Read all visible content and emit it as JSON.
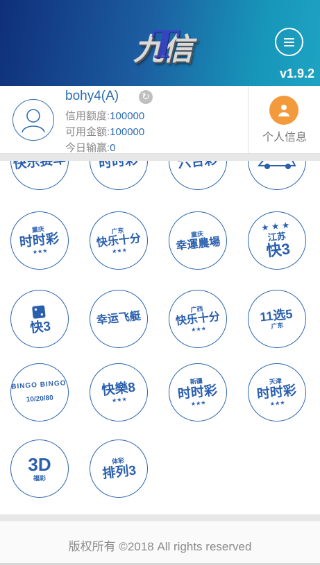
{
  "header": {
    "logo_text": "九信",
    "logo_t": "T",
    "version": "v1.9.2",
    "gradient_colors": [
      "#0f2f7a",
      "#1c5da0",
      "#1ea3c3"
    ]
  },
  "user": {
    "name": "bohy4",
    "level": "(A)",
    "credit_label": "信用额度:",
    "credit_value": "100000",
    "available_label": "可用金额:",
    "available_value": "100000",
    "winloss_label": "今日输赢:",
    "winloss_value": "0"
  },
  "personal": {
    "label": "个人信息",
    "icon": "person-icon",
    "color": "#f39a3c"
  },
  "games": [
    {
      "name": "快乐赛车",
      "sub": "",
      "icon": "kuaile-saiche-icon"
    },
    {
      "name": "时时彩",
      "sub": "",
      "icon": "shishicai-icon"
    },
    {
      "name": "六合彩",
      "sub": "",
      "icon": "liuhecai-icon"
    },
    {
      "name": "",
      "sub": "",
      "icon": "race-car-icon"
    },
    {
      "name": "时时彩",
      "sub": "重庆",
      "icon": "chongqing-shishicai-icon"
    },
    {
      "name": "快乐十分",
      "sub": "广东",
      "icon": "guangdong-kuaile-shifen-icon"
    },
    {
      "name": "幸運農場",
      "sub": "重庆",
      "icon": "xingyun-nongchang-icon"
    },
    {
      "name": "快3",
      "sub": "江苏",
      "icon": "jiangsu-kuai3-icon"
    },
    {
      "name": "快3",
      "sub": "",
      "icon": "kuai3-dice-icon"
    },
    {
      "name": "幸运飞艇",
      "sub": "",
      "icon": "xingyun-feiting-icon"
    },
    {
      "name": "快乐十分",
      "sub": "广西",
      "icon": "guangxi-kuaile-shifen-icon"
    },
    {
      "name": "11选5",
      "sub": "广东",
      "icon": "guangdong-11xuan5-icon"
    },
    {
      "name": "10/20/80",
      "sub": "BINGO BINGO",
      "icon": "bingo-icon"
    },
    {
      "name": "快樂8",
      "sub": "",
      "icon": "kuaile8-icon"
    },
    {
      "name": "时时彩",
      "sub": "新疆",
      "icon": "xinjiang-shishicai-icon"
    },
    {
      "name": "时时彩",
      "sub": "天津",
      "icon": "tianjin-shishicai-icon"
    },
    {
      "name": "3D",
      "sub": "福彩",
      "icon": "fucai-3d-icon"
    },
    {
      "name": "排列3",
      "sub": "体彩",
      "icon": "ticai-pailie3-icon"
    }
  ],
  "footer": {
    "copyright": "版权所有 ©2018 All rights reserved"
  }
}
